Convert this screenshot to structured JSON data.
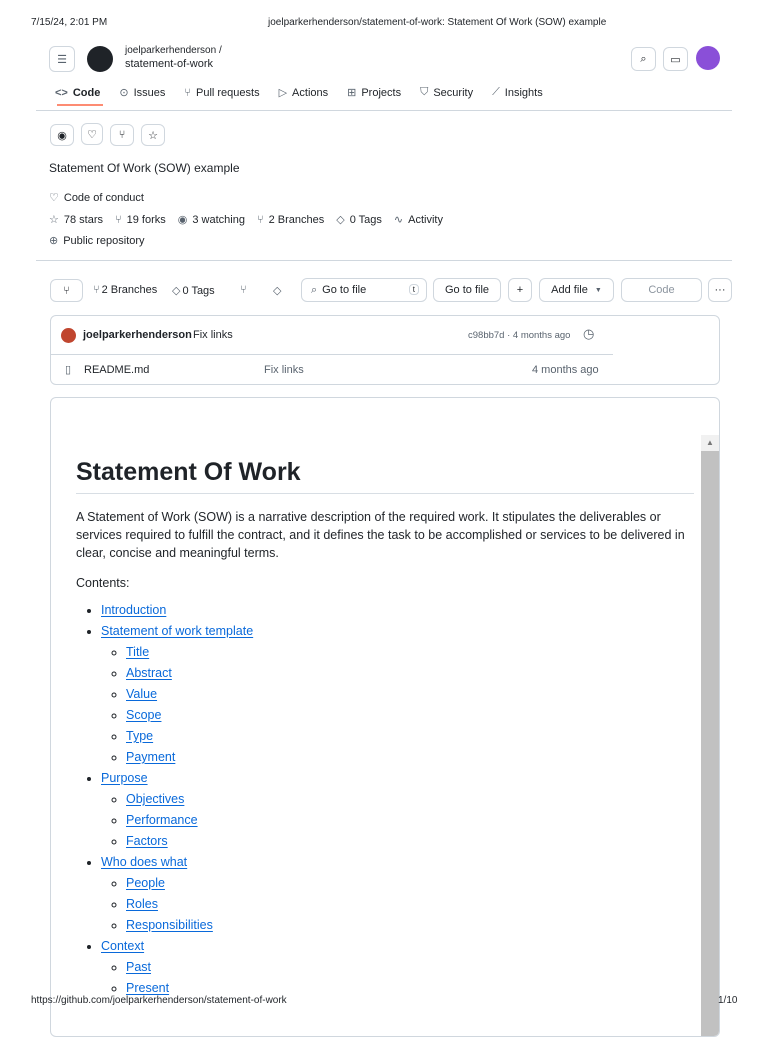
{
  "print_header": {
    "datetime": "7/15/24, 2:01 PM",
    "title": "joelparkerhenderson/statement-of-work: Statement Of Work (SOW) example"
  },
  "print_footer": {
    "url": "https://github.com/joelparkerhenderson/statement-of-work",
    "page": "1/10"
  },
  "repo": {
    "owner": "joelparkerhenderson /",
    "name": "statement-of-work",
    "description": "Statement Of Work (SOW) example"
  },
  "tabs": [
    {
      "label": "Code",
      "icon": "code-icon"
    },
    {
      "label": "Issues",
      "icon": "issue-icon"
    },
    {
      "label": "Pull requests",
      "icon": "pull-request-icon"
    },
    {
      "label": "Actions",
      "icon": "play-icon"
    },
    {
      "label": "Projects",
      "icon": "table-icon"
    },
    {
      "label": "Security",
      "icon": "shield-icon"
    },
    {
      "label": "Insights",
      "icon": "graph-icon"
    }
  ],
  "meta": {
    "code_of_conduct": "Code of conduct",
    "stars": "78 stars",
    "forks": "19 forks",
    "watching": "3 watching",
    "branches": "2 Branches",
    "tags": "0 Tags",
    "activity": "Activity",
    "visibility": "Public repository"
  },
  "toolbar": {
    "branches": "2 Branches",
    "tags": "0 Tags",
    "search_placeholder": "Go to file",
    "search_key": "t",
    "go_to_file": "Go to file",
    "add_file": "Add file",
    "code": "Code"
  },
  "commit": {
    "author": "joelparkerhenderson",
    "message": "Fix links",
    "hash_time": "c98bb7d · 4 months ago"
  },
  "files": [
    {
      "name": "README.md",
      "message": "Fix links",
      "time": "4 months ago"
    }
  ],
  "readme": {
    "title": "Statement Of Work",
    "intro": "A Statement of Work (SOW) is a narrative description of the required work. It stipulates the deliverables or services required to fulfill the contract, and it defines the task to be accomplished or services to be delivered in clear, concise and meaningful terms.",
    "contents_label": "Contents:",
    "toc": [
      {
        "label": "Introduction",
        "children": []
      },
      {
        "label": "Statement of work template",
        "children": [
          "Title",
          "Abstract",
          "Value",
          "Scope",
          "Type",
          "Payment"
        ]
      },
      {
        "label": "Purpose",
        "children": [
          "Objectives",
          "Performance",
          "Factors"
        ]
      },
      {
        "label": "Who does what",
        "children": [
          "People",
          "Roles",
          "Responsibilities"
        ]
      },
      {
        "label": "Context",
        "children": [
          "Past",
          "Present"
        ]
      }
    ]
  }
}
